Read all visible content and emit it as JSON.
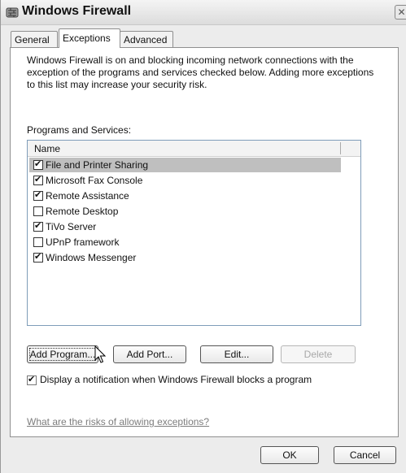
{
  "window": {
    "title": "Windows Firewall",
    "app_icon": "firewall-icon",
    "close_icon": "close-icon"
  },
  "tabs": [
    {
      "label": "General",
      "active": false
    },
    {
      "label": "Exceptions",
      "active": true
    },
    {
      "label": "Advanced",
      "active": false
    }
  ],
  "description": "Windows Firewall is on and blocking incoming network connections with the exception of the programs and services checked below. Adding more exceptions to this list may increase your security risk.",
  "programs_label": "Programs and Services:",
  "list": {
    "column_header": "Name",
    "items": [
      {
        "label": "File and Printer Sharing",
        "checked": true,
        "selected": true
      },
      {
        "label": "Microsoft  Fax Console",
        "checked": true,
        "selected": false
      },
      {
        "label": "Remote Assistance",
        "checked": true,
        "selected": false
      },
      {
        "label": "Remote Desktop",
        "checked": false,
        "selected": false
      },
      {
        "label": "TiVo Server",
        "checked": true,
        "selected": false
      },
      {
        "label": "UPnP framework",
        "checked": false,
        "selected": false
      },
      {
        "label": "Windows Messenger",
        "checked": true,
        "selected": false
      }
    ]
  },
  "buttons": {
    "add_program": "Add Program...",
    "add_port": "Add Port...",
    "edit": "Edit...",
    "delete": "Delete",
    "ok": "OK",
    "cancel": "Cancel"
  },
  "notify": {
    "label": "Display a notification when Windows Firewall blocks a program",
    "checked": true
  },
  "help_link": "What are the risks of allowing exceptions?",
  "cursor_icon": "mouse-pointer-icon",
  "check_glyph": "✔"
}
